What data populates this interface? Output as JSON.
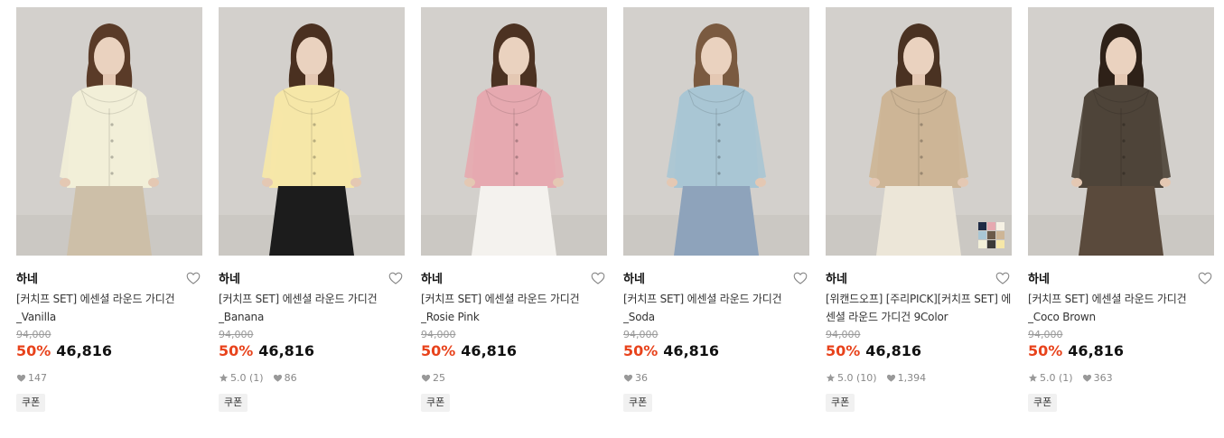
{
  "products": [
    {
      "brand": "하네",
      "title": "[커치프 SET] 에센셜 라운드 가디건 _Vanilla",
      "original_price": "94,000",
      "discount": "50%",
      "price": "46,816",
      "rating": "",
      "likes": "147",
      "coupon": "쿠폰",
      "colors": {
        "cardigan": "#f2efd8",
        "bottom": "#cdbfa8",
        "hair": "#5a3b28"
      }
    },
    {
      "brand": "하네",
      "title": "[커치프 SET] 에센셜 라운드 가디건 _Banana",
      "original_price": "94,000",
      "discount": "50%",
      "price": "46,816",
      "rating": "5.0 (1)",
      "likes": "86",
      "coupon": "쿠폰",
      "colors": {
        "cardigan": "#f6e7a8",
        "bottom": "#1c1c1c",
        "hair": "#4a3020"
      }
    },
    {
      "brand": "하네",
      "title": "[커치프 SET] 에센셜 라운드 가디건 _Rosie Pink",
      "original_price": "94,000",
      "discount": "50%",
      "price": "46,816",
      "rating": "",
      "likes": "25",
      "coupon": "쿠폰",
      "colors": {
        "cardigan": "#e6a9b0",
        "bottom": "#f4f2ee",
        "hair": "#4c3222"
      }
    },
    {
      "brand": "하네",
      "title": "[커치프 SET] 에센셜 라운드 가디건 _Soda",
      "original_price": "94,000",
      "discount": "50%",
      "price": "46,816",
      "rating": "",
      "likes": "36",
      "coupon": "쿠폰",
      "colors": {
        "cardigan": "#a9c6d4",
        "bottom": "#8ea3bb",
        "hair": "#7a5a40"
      }
    },
    {
      "brand": "하네",
      "title": "[위캔드오프] [주리PICK][커치프 SET] 에센셜 라운드 가디건 9Color",
      "original_price": "94,000",
      "discount": "50%",
      "price": "46,816",
      "rating": "5.0 (10)",
      "likes": "1,394",
      "coupon": "쿠폰",
      "colors": {
        "cardigan": "#cdb596",
        "bottom": "#ece6d8",
        "hair": "#4a3222"
      },
      "swatches": [
        "#1f2b45",
        "#e6a9b0",
        "#f6f1e4",
        "#a9c6d4",
        "#6b5a4a",
        "#cdb596",
        "#f2efd8",
        "#3c3a37",
        "#f6e7a8"
      ]
    },
    {
      "brand": "하네",
      "title": "[커치프 SET] 에센셜 라운드 가디건 _Coco Brown",
      "original_price": "94,000",
      "discount": "50%",
      "price": "46,816",
      "rating": "5.0 (1)",
      "likes": "363",
      "coupon": "쿠폰",
      "colors": {
        "cardigan": "#4e4439",
        "bottom": "#5a4a3c",
        "hair": "#2e2118"
      }
    }
  ]
}
